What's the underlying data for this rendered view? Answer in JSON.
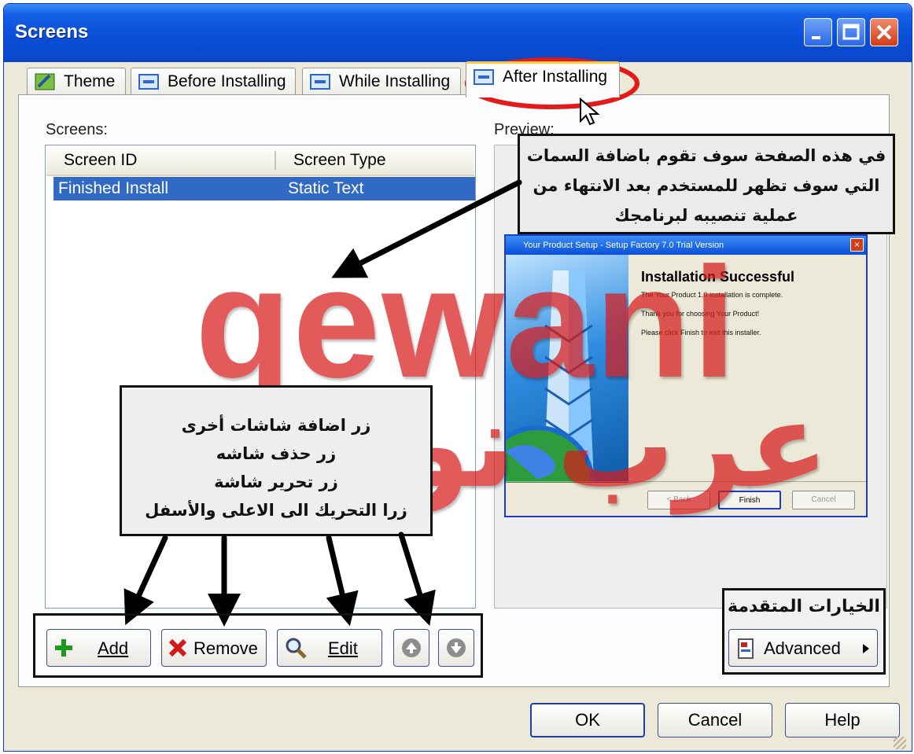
{
  "window": {
    "title": "Screens"
  },
  "tabs": [
    {
      "label": "Theme"
    },
    {
      "label": "Before Installing"
    },
    {
      "label": "While Installing"
    },
    {
      "label": "After Installing",
      "active": true
    }
  ],
  "screens": {
    "label": "Screens:",
    "columns": [
      "Screen ID",
      "Screen Type"
    ],
    "rows": [
      {
        "id": "Finished Install",
        "type": "Static Text",
        "selected": true
      }
    ]
  },
  "preview": {
    "label": "Preview:",
    "window_title": "Your Product Setup - Setup Factory 7.0 Trial Version",
    "heading": "Installation Successful",
    "lines": [
      "The Your Product 1.0 installation is complete.",
      "Thank you for choosing Your Product!",
      "Please click Finish to exit this installer."
    ],
    "buttons": [
      "< Back",
      "Finish",
      "Cancel"
    ]
  },
  "buttons": {
    "add": "Add",
    "remove": "Remove",
    "edit": "Edit",
    "advanced": "Advanced",
    "ok": "OK",
    "cancel": "Cancel",
    "help": "Help"
  },
  "annotations": {
    "preview_note": [
      "في هذه الصفحة سوف تقوم باضافة السمات",
      "التي سوف تظهر للمستخدم بعد الانتهاء من",
      "عملية تنصيبه لبرنامجك"
    ],
    "buttons_note": [
      "زر اضافة شاشات أخرى",
      "زر حذف شاشه",
      "زر تحرير شاشة",
      "زرا التحريك الى الاعلى والأسفل"
    ],
    "advanced_note": "الخيارات المتقدمة"
  },
  "watermark": {
    "latin": "qewani",
    "arabic": "عرب نوكيا"
  },
  "colors": {
    "selection": "#316ac5",
    "title_bar": "#0a4fd8",
    "watermark": "#d71c1c",
    "tab_highlight": "#ffc83c"
  }
}
